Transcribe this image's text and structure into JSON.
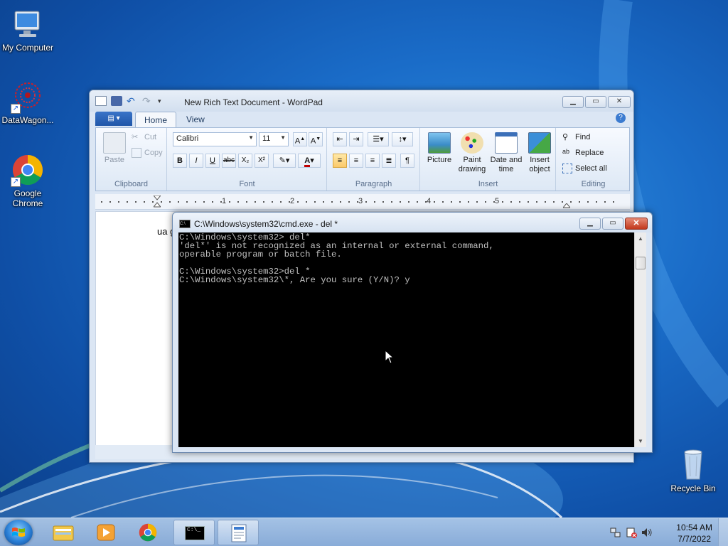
{
  "desktop": {
    "icons": [
      {
        "label": "My Computer"
      },
      {
        "label": "DataWagon..."
      },
      {
        "label": "Google Chrome"
      },
      {
        "label": "Recycle Bin"
      }
    ]
  },
  "wordpad": {
    "title": "New Rich Text Document - WordPad",
    "tabs": [
      "Home",
      "View"
    ],
    "clipboard": {
      "paste": "Paste",
      "cut": "Cut",
      "copy": "Copy",
      "label": "Clipboard"
    },
    "font": {
      "family": "Calibri",
      "size": "11",
      "label": "Font"
    },
    "paragraph": {
      "label": "Paragraph"
    },
    "insert": {
      "picture": "Picture",
      "paint": "Paint drawing",
      "datetime": "Date and time",
      "object": "Insert object",
      "label": "Insert"
    },
    "editing": {
      "find": "Find",
      "replace": "Replace",
      "select_all": "Select all",
      "label": "Editing"
    },
    "ruler_numbers": [
      "1",
      "2",
      "3",
      "4",
      "5"
    ],
    "document_text": "ua g"
  },
  "cmd": {
    "title": "C:\\Windows\\system32\\cmd.exe - del  *",
    "output": "C:\\Windows\\system32> del*\n'del*' is not recognized as an internal or external command,\noperable program or batch file.\n\nC:\\Windows\\system32>del *\nC:\\Windows\\system32\\*, Are you sure (Y/N)? y"
  },
  "taskbar": {
    "time": "10:54 AM",
    "date": "7/7/2022"
  }
}
